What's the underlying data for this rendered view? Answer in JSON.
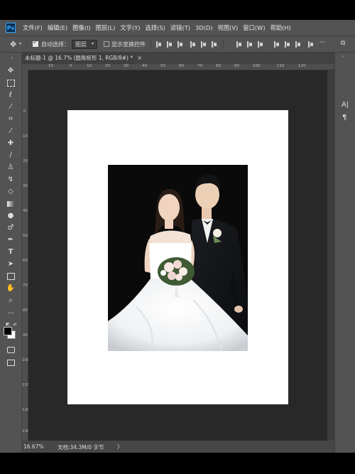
{
  "app": {
    "logo": "Ps"
  },
  "menu": [
    "文件(F)",
    "编辑(E)",
    "图像(I)",
    "图层(L)",
    "文字(Y)",
    "选择(S)",
    "滤镜(T)",
    "3D(D)",
    "视图(V)",
    "窗口(W)",
    "帮助(H)"
  ],
  "options": {
    "auto_select_label": "自动选择：",
    "auto_select_checked": true,
    "layer_dropdown": "图层",
    "show_transform_label": "显示变换控件",
    "show_transform_checked": false
  },
  "document": {
    "tab_title": "未标题-1 @ 16.7% (圆角矩形 1, RGB/8#) *",
    "close_glyph": "×"
  },
  "ruler": {
    "h_ticks": [
      "10",
      "0",
      "10",
      "20",
      "30",
      "40",
      "50",
      "60",
      "70",
      "80",
      "90",
      "100",
      "110",
      "120"
    ],
    "v_ticks": [
      "0",
      "10",
      "20",
      "30",
      "40",
      "50",
      "60",
      "70",
      "80",
      "90",
      "100",
      "110",
      "120",
      "130"
    ]
  },
  "status": {
    "zoom": "16.67%",
    "doc_info": "文档:34.3M/0 字节"
  },
  "colors": {
    "foreground": "#000000",
    "background": "#ffffff",
    "ui_panel": "#535353",
    "pasteboard": "#282828"
  },
  "right_panel": {
    "char_label": "A|"
  }
}
